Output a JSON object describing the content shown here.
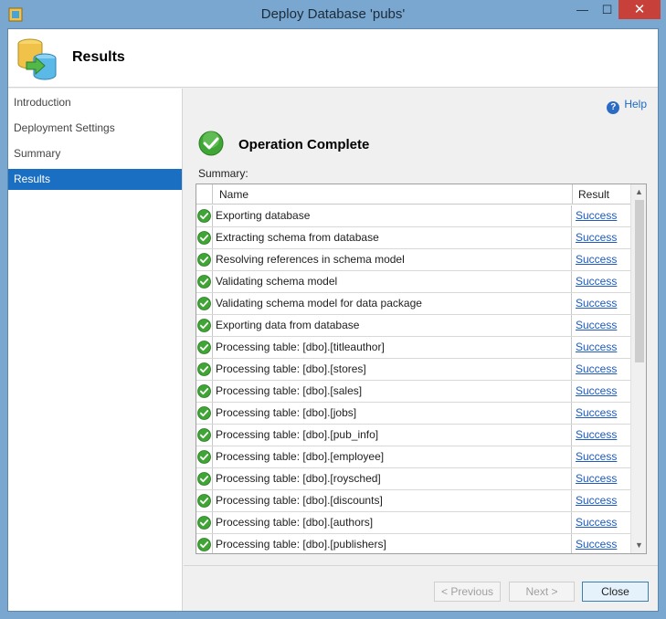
{
  "window": {
    "title": "Deploy Database 'pubs'",
    "minimize_glyph": "—",
    "maximize_glyph": "☐",
    "close_glyph": "✕"
  },
  "header": {
    "title": "Results"
  },
  "nav": {
    "items": [
      {
        "label": "Introduction"
      },
      {
        "label": "Deployment Settings"
      },
      {
        "label": "Summary"
      },
      {
        "label": "Results",
        "selected": true
      }
    ]
  },
  "main": {
    "help_label": "Help",
    "operation_title": "Operation Complete",
    "summary_label": "Summary:",
    "columns": {
      "name": "Name",
      "result": "Result"
    },
    "rows": [
      {
        "name": "Exporting database",
        "result": "Success"
      },
      {
        "name": "Extracting schema from database",
        "result": "Success"
      },
      {
        "name": "Resolving references in schema model",
        "result": "Success"
      },
      {
        "name": "Validating schema model",
        "result": "Success"
      },
      {
        "name": "Validating schema model for data package",
        "result": "Success"
      },
      {
        "name": "Exporting data from database",
        "result": "Success"
      },
      {
        "name": "Processing table: [dbo].[titleauthor]",
        "result": "Success"
      },
      {
        "name": "Processing table: [dbo].[stores]",
        "result": "Success"
      },
      {
        "name": "Processing table: [dbo].[sales]",
        "result": "Success"
      },
      {
        "name": "Processing table: [dbo].[jobs]",
        "result": "Success"
      },
      {
        "name": "Processing table: [dbo].[pub_info]",
        "result": "Success"
      },
      {
        "name": "Processing table: [dbo].[employee]",
        "result": "Success"
      },
      {
        "name": "Processing table: [dbo].[roysched]",
        "result": "Success"
      },
      {
        "name": "Processing table: [dbo].[discounts]",
        "result": "Success"
      },
      {
        "name": "Processing table: [dbo].[authors]",
        "result": "Success"
      },
      {
        "name": "Processing table: [dbo].[publishers]",
        "result": "Success"
      }
    ]
  },
  "buttons": {
    "previous": "< Previous",
    "next": "Next >",
    "close": "Close"
  },
  "colors": {
    "titlebar": "#7aa7cf",
    "selection": "#1b6fc2",
    "link": "#1d5ac2",
    "success_green": "#3fa535"
  },
  "icons": {
    "row_status": "success-check-icon",
    "header": "database-deploy-icon",
    "help": "help-icon"
  }
}
